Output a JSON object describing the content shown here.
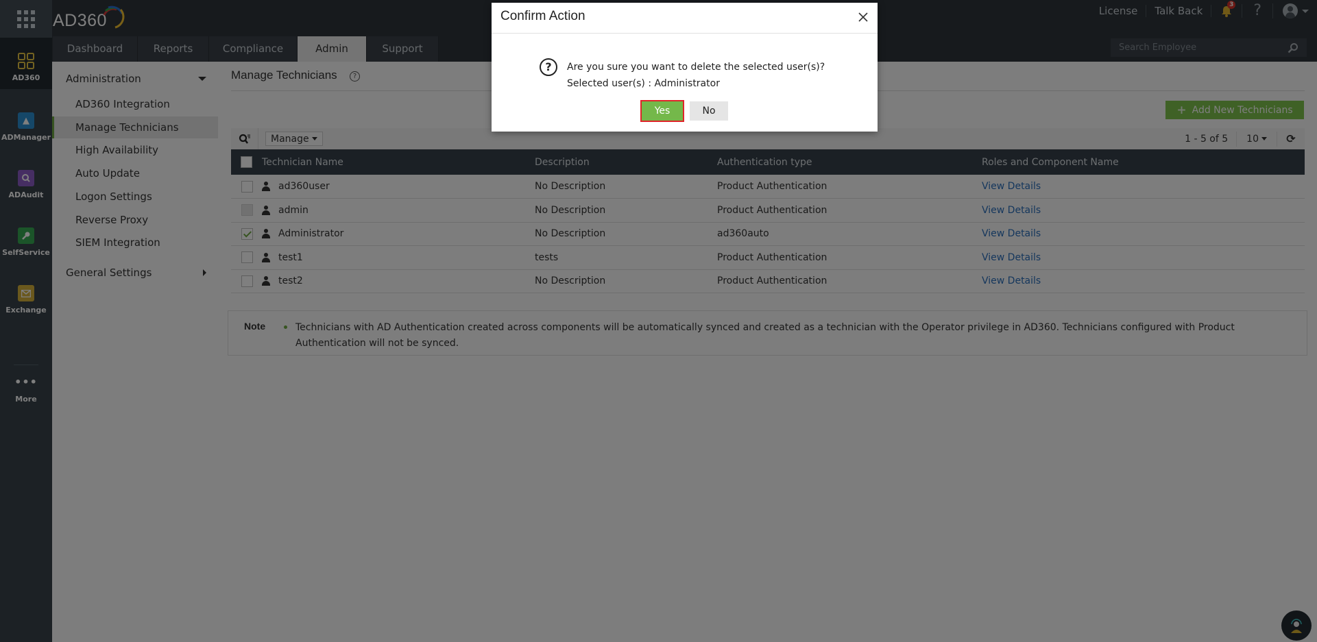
{
  "header": {
    "brand": "AD360",
    "top_links": [
      "License",
      "Talk Back"
    ],
    "notification_count": "3",
    "help_label": "?",
    "search": {
      "placeholder": "Search Employee"
    },
    "tabs": [
      {
        "label": "Dashboard",
        "active": false
      },
      {
        "label": "Reports",
        "active": false
      },
      {
        "label": "Compliance",
        "active": false
      },
      {
        "label": "Admin",
        "active": true
      },
      {
        "label": "Support",
        "active": false
      }
    ]
  },
  "rail": {
    "items": [
      {
        "label": "AD360",
        "icon": "grid-icon",
        "color": "#e6c542"
      },
      {
        "label": "ADManager",
        "icon": "admanager-icon",
        "color": "#2b8fd1"
      },
      {
        "label": "ADAudit",
        "icon": "adaudit-icon",
        "color": "#8c5cc7"
      },
      {
        "label": "SelfService",
        "icon": "key-icon",
        "color": "#36a853"
      },
      {
        "label": "Exchange",
        "icon": "envelope-icon",
        "color": "#d4b13a"
      },
      {
        "label": "More",
        "icon": "more-dots-icon",
        "color": "#ffffff"
      }
    ]
  },
  "submenu": {
    "administration": "Administration",
    "items": [
      "AD360 Integration",
      "Manage Technicians",
      "High Availability",
      "Auto Update",
      "Logon Settings",
      "Reverse Proxy",
      "SIEM Integration"
    ],
    "active_index": 1,
    "general_settings": "General Settings"
  },
  "main": {
    "title": "Manage Technicians",
    "help_icon": "?",
    "add_button": "Add New Technicians",
    "manage_label": "Manage",
    "pager_range": "1 - 5 of 5",
    "per_page": "10",
    "columns": [
      "Technician Name",
      "Description",
      "Authentication type",
      "Roles and Component Name"
    ],
    "rows": [
      {
        "name": "ad360user",
        "description": "No Description",
        "auth": "Product Authentication",
        "roles": "View Details",
        "checked": false,
        "disabled": false
      },
      {
        "name": "admin",
        "description": "No Description",
        "auth": "Product Authentication",
        "roles": "View Details",
        "checked": false,
        "disabled": true
      },
      {
        "name": "Administrator",
        "description": "No Description",
        "auth": "ad360auto",
        "roles": "View Details",
        "checked": true,
        "disabled": false
      },
      {
        "name": "test1",
        "description": "tests",
        "auth": "Product Authentication",
        "roles": "View Details",
        "checked": false,
        "disabled": false
      },
      {
        "name": "test2",
        "description": "No Description",
        "auth": "Product Authentication",
        "roles": "View Details",
        "checked": false,
        "disabled": false
      }
    ],
    "note_label": "Note",
    "note_text": "Technicians with AD Authentication created across components will be automatically synced and created as a technician with the Operator privilege in AD360. Technicians configured with Product Authentication will not be synced."
  },
  "dialog": {
    "title": "Confirm Action",
    "question": "Are you sure you want to delete the selected user(s)?",
    "selected": "Selected user(s) : Administrator",
    "yes": "Yes",
    "no": "No"
  },
  "colors": {
    "accent_green": "#74b84a",
    "header_bg": "#2f353b",
    "link_blue": "#2a6ebb",
    "highlight_red": "#e0242a"
  }
}
